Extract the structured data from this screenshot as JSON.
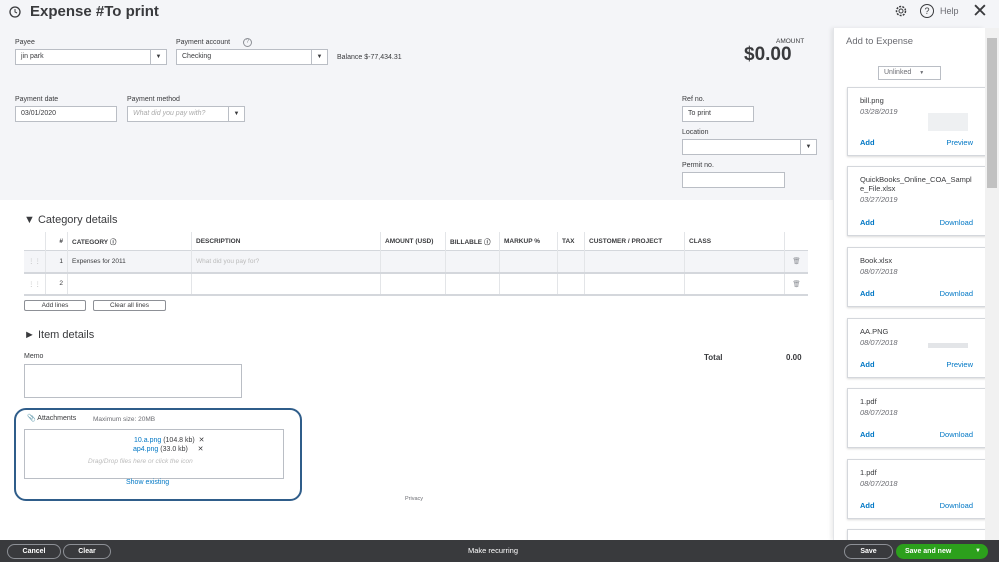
{
  "header": {
    "title": "Expense #To print",
    "help": "Help"
  },
  "form": {
    "payee_label": "Payee",
    "payee_value": "jin park",
    "account_label": "Payment account",
    "account_value": "Checking",
    "balance": "Balance $-77,434.31",
    "amount_label": "AMOUNT",
    "amount_value": "$0.00",
    "date_label": "Payment date",
    "date_value": "03/01/2020",
    "method_label": "Payment method",
    "method_placeholder": "What did you pay with?",
    "ref_label": "Ref no.",
    "ref_value": "To print",
    "location_label": "Location",
    "permit_label": "Permit no."
  },
  "category": {
    "title": "Category details",
    "columns": [
      "#",
      "CATEGORY",
      "DESCRIPTION",
      "AMOUNT (USD)",
      "BILLABLE",
      "MARKUP %",
      "TAX",
      "CUSTOMER / PROJECT",
      "CLASS"
    ],
    "rows": [
      {
        "num": "1",
        "category": "Expenses for 2011",
        "description_placeholder": "What did you pay for?"
      },
      {
        "num": "2",
        "category": "",
        "description_placeholder": ""
      }
    ],
    "add_lines": "Add lines",
    "clear_lines": "Clear all lines"
  },
  "item": {
    "title": "Item details"
  },
  "memo_label": "Memo",
  "total_label": "Total",
  "total_value": "0.00",
  "attachments": {
    "label": "Attachments",
    "max": "Maximum size: 20MB",
    "files": [
      {
        "name": "10.a.png",
        "size": "(104.8 kb)"
      },
      {
        "name": "ap4.png",
        "size": "(33.0 kb)"
      }
    ],
    "drop_hint": "Drag/Drop files here or click the icon",
    "show_existing": "Show existing"
  },
  "privacy": "Privacy",
  "panel": {
    "title": "Add to Expense",
    "filter": "Unlinked",
    "cards": [
      {
        "name": "bill.png",
        "date": "03/28/2019",
        "add": "Add",
        "action": "Preview"
      },
      {
        "name": "QuickBooks_Online_COA_Sample_File.xlsx",
        "date": "03/27/2019",
        "add": "Add",
        "action": "Download"
      },
      {
        "name": "Book.xlsx",
        "date": "08/07/2018",
        "add": "Add",
        "action": "Download"
      },
      {
        "name": "AA.PNG",
        "date": "08/07/2018",
        "add": "Add",
        "action": "Preview"
      },
      {
        "name": "1.pdf",
        "date": "08/07/2018",
        "add": "Add",
        "action": "Download"
      },
      {
        "name": "1.pdf",
        "date": "08/07/2018",
        "add": "Add",
        "action": "Download"
      }
    ]
  },
  "footer": {
    "cancel": "Cancel",
    "clear": "Clear",
    "recurring": "Make recurring",
    "save": "Save",
    "save_new": "Save and new"
  },
  "colors": {
    "accent": "#2ca01c",
    "link": "#0077c5",
    "bar": "#393a3d",
    "highlight": "#2f5d8a"
  }
}
